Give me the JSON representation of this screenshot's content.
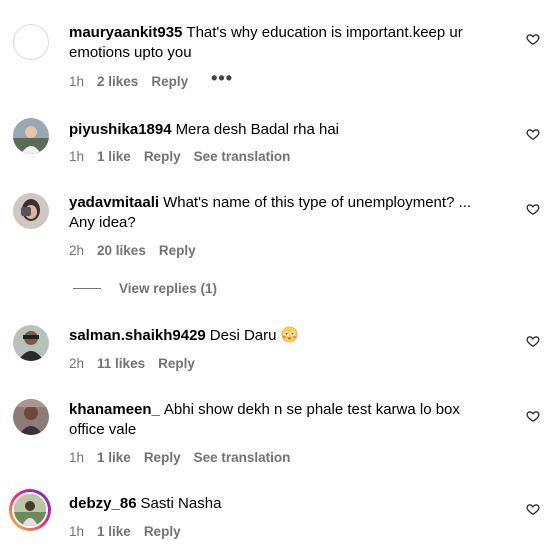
{
  "comments": [
    {
      "username": "mauryaankit935",
      "text": "That's why education is important.keep ur emotions upto you",
      "time": "1h",
      "likes": "2 likes",
      "reply": "Reply",
      "more": "•••"
    },
    {
      "username": "piyushika1894",
      "text": "Mera desh Badal rha hai",
      "time": "1h",
      "likes": "1 like",
      "reply": "Reply",
      "translate": "See translation"
    },
    {
      "username": "yadavmitaali",
      "text": "What's name of this type of unemployment? ... Any idea?",
      "time": "2h",
      "likes": "20 likes",
      "reply": "Reply",
      "view_replies": "View replies (1)"
    },
    {
      "username": "salman.shaikh9429",
      "text": "Desi Daru",
      "emoji": "flushed-face",
      "time": "2h",
      "likes": "11 likes",
      "reply": "Reply"
    },
    {
      "username": "khanameen_",
      "text": "Abhi show dekh n se phale test karwa lo box office vale",
      "time": "1h",
      "likes": "1 like",
      "reply": "Reply",
      "translate": "See translation"
    },
    {
      "username": "debzy_86",
      "text": "Sasti Nasha",
      "time": "1h",
      "likes": "1 like",
      "reply": "Reply"
    }
  ],
  "icons": {
    "like": "heart-outline-icon"
  }
}
